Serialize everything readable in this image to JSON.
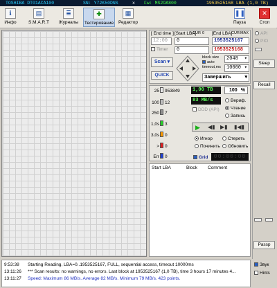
{
  "titlebar": {
    "model": "TOSHIBA DT01ACA100",
    "serial": "SN: Y72K50DNS",
    "close": "x",
    "firmware": "Fw: MS2OA800",
    "lba": "1953525168 LBA (1,0 TB)"
  },
  "toolbar": {
    "buttons": [
      {
        "label": "Инфо",
        "icon": "info-icon"
      },
      {
        "label": "S.M.A.R.T",
        "icon": "smart-icon"
      },
      {
        "label": "Журналы",
        "icon": "logs-icon"
      },
      {
        "label": "Тестирование",
        "icon": "test-icon"
      },
      {
        "label": "Редактор",
        "icon": "editor-icon"
      }
    ],
    "pause_label": "Пауза",
    "stop_label": "Стоп"
  },
  "controls": {
    "end_time_label": "[ End time ]",
    "start_lba_label": "[Start LBA]",
    "start_lba_cur": "CUR",
    "zero": "0",
    "end_lba_label": "[End LBA]",
    "end_lba_cur": "CUR",
    "end_lba_max": "MAX",
    "time_value": "12:00",
    "start_lba_value": "0",
    "end_lba_value": "1953525167",
    "timer_label": "Timer",
    "timer_value": "0",
    "current_lba_value": "1953525168",
    "scan_label": "Scan",
    "quick_label": "QUICK",
    "block_size_label": "block size",
    "auto_label": "auto",
    "timeout_label": "timeout,ms",
    "block_size_value": "2048",
    "timeout_value": "10000",
    "action_value": "Завершить"
  },
  "legend": [
    {
      "label": "25",
      "count": "953849",
      "color": "#e8e8e8"
    },
    {
      "label": "100",
      "count": "12",
      "color": "#c0c0c0"
    },
    {
      "label": "250",
      "count": "7",
      "color": "#909090"
    },
    {
      "label": "1,0s",
      "count": "3",
      "color": "#28d028"
    },
    {
      "label": "3,0s",
      "count": "0",
      "color": "#ff9a00"
    },
    {
      "label": ">",
      "count": "0",
      "color": "#e02020"
    },
    {
      "label": "Err",
      "count": "0",
      "color": "#2040d0"
    }
  ],
  "stats": {
    "size": "1,00 TB",
    "percent": "100",
    "percent_sign": "%",
    "speed": "83 MB/s",
    "ddd_label": "DDD (API)",
    "verify_label": "Вериф.",
    "read_label": "Чтение",
    "write_label": "Запись",
    "ignore_label": "Игнор",
    "erase_label": "Стереть",
    "repair_label": "Починить",
    "refresh_label": "Обновить",
    "grid_label": "Grid",
    "timer_display": "00:00:00"
  },
  "table": {
    "col1": "Start LBA",
    "col2": "Block",
    "col3": "Comment"
  },
  "side": {
    "api_label": "API",
    "pio_label": "PIO",
    "sleep_label": "Sleep",
    "recall_label": "Recall",
    "passp_label": "Passp"
  },
  "log": [
    {
      "time": "9:53:38",
      "text": "Starting Reading, LBA=0..1953525167, FULL, sequential access, timeout 10000ms",
      "blue": false
    },
    {
      "time": "13:11:26",
      "text": "*** Scan results: no warnings, no errors. Last block at 1953525167 (1,0 TB), time 3 hours 17 minutes 4...",
      "blue": false
    },
    {
      "time": "13:11:27",
      "text": "Speed: Maximum 86 MB/s. Average 82 MB/s. Minimum 79 MB/s. 423 points.",
      "blue": true
    }
  ],
  "log_options": {
    "sound_label": "Звук",
    "hints_label": "Hints"
  }
}
